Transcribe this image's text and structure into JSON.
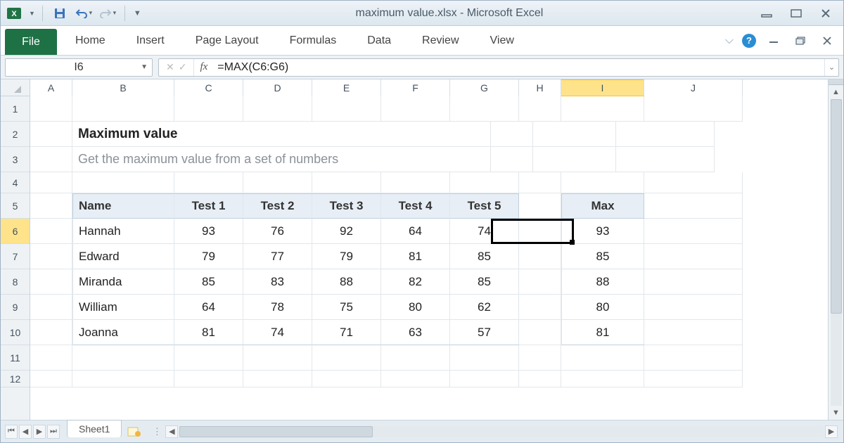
{
  "title": "maximum value.xlsx  -  Microsoft Excel",
  "ribbon": {
    "file": "File",
    "tabs": [
      "Home",
      "Insert",
      "Page Layout",
      "Formulas",
      "Data",
      "Review",
      "View"
    ]
  },
  "namebox": "I6",
  "fx_label": "fx",
  "formula": "=MAX(C6:G6)",
  "columns": [
    "A",
    "B",
    "C",
    "D",
    "E",
    "F",
    "G",
    "H",
    "I",
    "J"
  ],
  "rows": [
    "1",
    "2",
    "3",
    "4",
    "5",
    "6",
    "7",
    "8",
    "9",
    "10",
    "11",
    "12"
  ],
  "selected_col": "I",
  "selected_row": "6",
  "heading": "Maximum value",
  "subheading": "Get the maximum value from a set of numbers",
  "table": {
    "headers": [
      "Name",
      "Test 1",
      "Test 2",
      "Test 3",
      "Test 4",
      "Test 5"
    ],
    "max_header": "Max",
    "rows": [
      {
        "name": "Hannah",
        "t": [
          93,
          76,
          92,
          64,
          74
        ],
        "max": 93
      },
      {
        "name": "Edward",
        "t": [
          79,
          77,
          79,
          81,
          85
        ],
        "max": 85
      },
      {
        "name": "Miranda",
        "t": [
          85,
          83,
          88,
          82,
          85
        ],
        "max": 88
      },
      {
        "name": "William",
        "t": [
          64,
          78,
          75,
          80,
          62
        ],
        "max": 80
      },
      {
        "name": "Joanna",
        "t": [
          81,
          74,
          71,
          63,
          57
        ],
        "max": 81
      }
    ]
  },
  "sheet_tab": "Sheet1"
}
